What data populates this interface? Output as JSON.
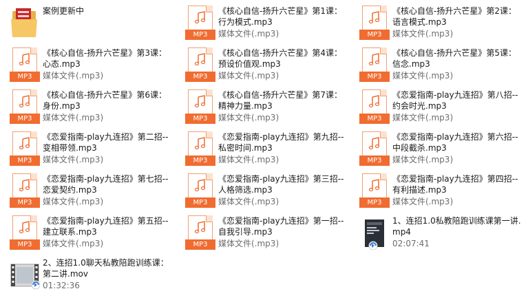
{
  "row1": [
    {
      "name": "案例更新中",
      "type": "",
      "kind": "folder"
    },
    {
      "name": "《核心自信-扬升六芒星》第1课：\n行为模式.mp3",
      "type": "媒体文件(.mp3)",
      "kind": "mp3"
    },
    {
      "name": "《核心自信-扬升六芒星》第2课：\n语言模式.mp3",
      "type": "媒体文件(.mp3)",
      "kind": "mp3"
    }
  ],
  "row2": [
    {
      "name": "《核心自信-扬升六芒星》第3课：\n心态.mp3",
      "type": "媒体文件(.mp3)",
      "kind": "mp3"
    },
    {
      "name": "《核心自信-扬升六芒星》第4课：\n预设价值观.mp3",
      "type": "媒体文件(.mp3)",
      "kind": "mp3"
    },
    {
      "name": "《核心自信-扬升六芒星》第5课：\n信念.mp3",
      "type": "媒体文件(.mp3)",
      "kind": "mp3"
    }
  ],
  "row3": [
    {
      "name": "《核心自信-扬升六芒星》第6课：\n身份.mp3",
      "type": "媒体文件(.mp3)",
      "kind": "mp3"
    },
    {
      "name": "《核心自信-扬升六芒星》第7课：\n精神力量.mp3",
      "type": "媒体文件(.mp3)",
      "kind": "mp3"
    },
    {
      "name": "《恋爱指南-play九连招》第八招--\n约会时光.mp3",
      "type": "媒体文件(.mp3)",
      "kind": "mp3"
    }
  ],
  "row4": [
    {
      "name": "《恋爱指南-play九连招》第二招--\n变相带领.mp3",
      "type": "媒体文件(.mp3)",
      "kind": "mp3"
    },
    {
      "name": "《恋爱指南-play九连招》第九招--\n私密时间.mp3",
      "type": "媒体文件(.mp3)",
      "kind": "mp3"
    },
    {
      "name": "《恋爱指南-play九连招》第六招--\n中段截杀.mp3",
      "type": "媒体文件(.mp3)",
      "kind": "mp3"
    }
  ],
  "row5": [
    {
      "name": "《恋爱指南-play九连招》第七招--\n恋爱契约.mp3",
      "type": "媒体文件(.mp3)",
      "kind": "mp3"
    },
    {
      "name": "《恋爱指南-play九连招》第三招--\n人格筛选.mp3",
      "type": "媒体文件(.mp3)",
      "kind": "mp3"
    },
    {
      "name": "《恋爱指南-play九连招》第四招--\n有利描述.mp3",
      "type": "媒体文件(.mp3)",
      "kind": "mp3"
    }
  ],
  "row6": [
    {
      "name": "《恋爱指南-play九连招》第五招--\n建立联系.mp3",
      "type": "媒体文件(.mp3)",
      "kind": "mp3"
    },
    {
      "name": "《恋爱指南-play九连招》第一招--\n自我引导.mp3",
      "type": "媒体文件(.mp3)",
      "kind": "mp3"
    },
    {
      "name": "1、连招1.0私教陪跑训练课第一讲.\nmp4",
      "type": "02:07:41",
      "kind": "mp4"
    }
  ],
  "row7": [
    {
      "name": "2、连招1.0聊天私教陪跑训练课：\n第二讲.mov",
      "type": "01:32:36",
      "kind": "mov"
    }
  ],
  "icon_band_label": "MP3",
  "colors": {
    "mp3_accent": "#f06c30",
    "folder": "#e8b04a",
    "text_meta": "#6d6d6d"
  },
  "icon_names": {
    "folder": "folder-icon",
    "mp3": "mp3-file-icon",
    "mp4": "video-thumbnail-icon",
    "mov": "video-file-icon"
  }
}
